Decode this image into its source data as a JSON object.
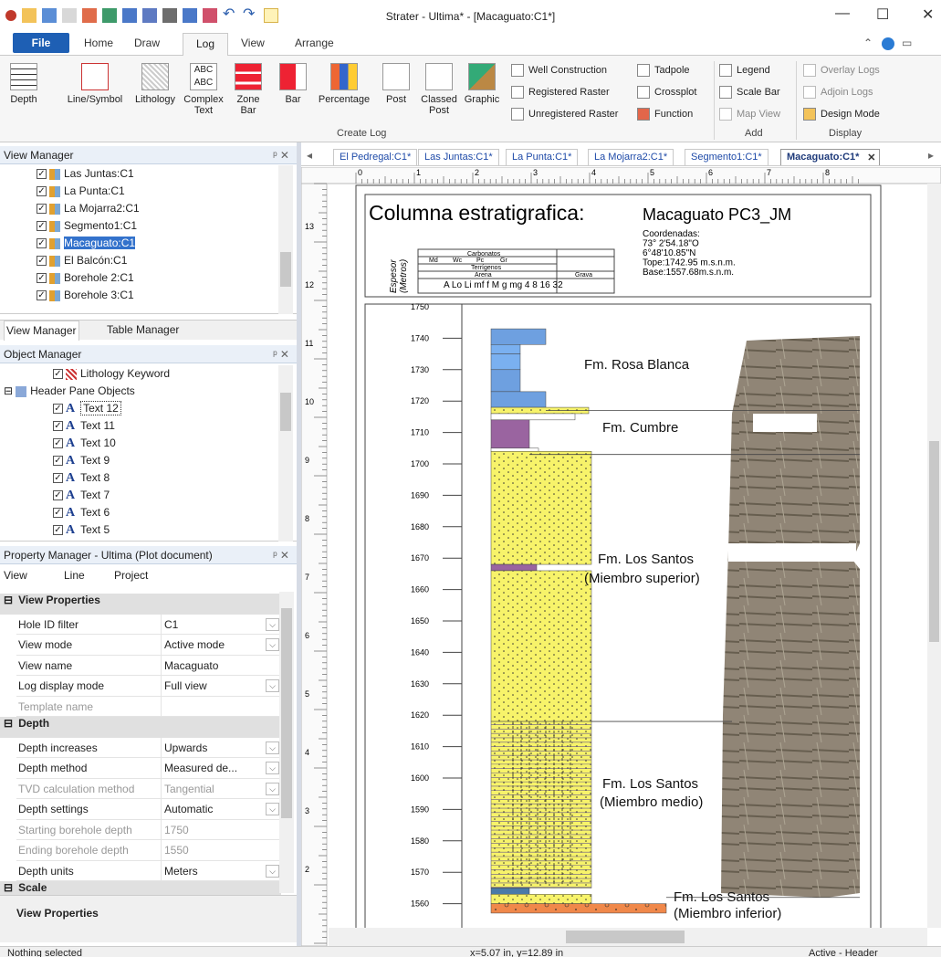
{
  "window": {
    "title": "Strater - Ultima* - [Macaguato:C1*]"
  },
  "ribbon_tabs": [
    "File",
    "Home",
    "Draw",
    "Log",
    "View",
    "Arrange"
  ],
  "ribbon": {
    "create_log": [
      "Depth",
      "Line/Symbol",
      "Lithology",
      "Complex\nText",
      "Zone\nBar",
      "Bar",
      "Percentage",
      "Post",
      "Classed\nPost",
      "Graphic"
    ],
    "create_log_small": [
      "Well Construction",
      "Registered Raster",
      "Unregistered Raster",
      "Tadpole",
      "Crossplot",
      "Function"
    ],
    "add": [
      "Legend",
      "Scale Bar",
      "Map View"
    ],
    "display": [
      "Overlay Logs",
      "Adjoin Logs",
      "Design Mode"
    ],
    "groups": {
      "create": "Create Log",
      "add": "Add",
      "display": "Display"
    }
  },
  "view_manager": {
    "title": "View Manager",
    "items": [
      "Las Juntas:C1",
      "La Punta:C1",
      "La Mojarra2:C1",
      "Segmento1:C1",
      "Macaguato:C1",
      "El Balcón:C1",
      "Borehole 2:C1",
      "Borehole 3:C1"
    ],
    "selected": "Macaguato:C1",
    "tabs": [
      "View Manager",
      "Table Manager"
    ]
  },
  "object_manager": {
    "title": "Object Manager",
    "items": [
      "Lithology Keyword",
      "Header Pane Objects",
      "Text 12",
      "Text 11",
      "Text 10",
      "Text 9",
      "Text 8",
      "Text 7",
      "Text 6",
      "Text 5"
    ]
  },
  "property_manager": {
    "title": "Property Manager - Ultima (Plot document)",
    "tabs": [
      "View",
      "Line",
      "Project"
    ],
    "sections": [
      {
        "name": "View Properties",
        "rows": [
          {
            "name": "Hole ID filter",
            "value": "C1",
            "dd": true
          },
          {
            "name": "View mode",
            "value": "Active mode",
            "dd": true
          },
          {
            "name": "View name",
            "value": "Macaguato",
            "dd": false
          },
          {
            "name": "Log display mode",
            "value": "Full view",
            "dd": true
          },
          {
            "name": "Template name",
            "value": "",
            "dd": false,
            "dis": true
          }
        ]
      },
      {
        "name": "Depth",
        "rows": [
          {
            "name": "Depth increases",
            "value": "Upwards",
            "dd": true
          },
          {
            "name": "Depth method",
            "value": "Measured de...",
            "dd": true
          },
          {
            "name": "TVD calculation method",
            "value": "Tangential",
            "dd": true,
            "dis": true
          },
          {
            "name": "Depth settings",
            "value": "Automatic",
            "dd": true
          },
          {
            "name": "Starting borehole depth",
            "value": "1750",
            "dd": false,
            "dis": true
          },
          {
            "name": "Ending borehole depth",
            "value": "1550",
            "dd": false,
            "dis": true
          },
          {
            "name": "Depth units",
            "value": "Meters",
            "dd": true
          }
        ]
      },
      {
        "name": "Scale",
        "rows": []
      }
    ],
    "footer": "View Properties"
  },
  "doc_tabs": [
    "El Pedregal:C1*",
    "Las Juntas:C1*",
    "La Punta:C1*",
    "La Mojarra2:C1*",
    "Segmento1:C1*",
    "Macaguato:C1*"
  ],
  "active_doc_tab": "Macaguato:C1*",
  "plot": {
    "title_main": "Columna estratigrafica:",
    "title_sub": "Macaguato PC3_JM",
    "coords": [
      "Coordenadas:",
      "73° 2'54.18\"O",
      "6°48'10.85\"N",
      "Tope:1742.95 m.s.n.m.",
      "Base:1557.68m.s.n.m."
    ],
    "legend": {
      "carbonatos": "Carbonatos",
      "carb_cols": [
        "Md",
        "Wc",
        "Pc",
        "Gr"
      ],
      "terrigenos": "Terrígenos",
      "arena": "Arena",
      "grava": "Grava",
      "scale": "A Lo Li  mf  f  M  g mg 4  8 16 32",
      "axis": "Espesor\n(Metros)"
    },
    "depths": [
      "1750",
      "1740",
      "1730",
      "1720",
      "1710",
      "1700",
      "1690",
      "1680",
      "1670",
      "1660",
      "1650",
      "1640",
      "1630",
      "1620",
      "1610",
      "1600",
      "1590",
      "1580",
      "1570",
      "1560"
    ],
    "formations": [
      "Fm. Rosa Blanca",
      "Fm. Cumbre",
      "Fm. Los Santos\n(Miembro superior)",
      "Fm. Los Santos\n(Miembro medio)",
      "Fm. Los Santos\n(Miembro inferior)"
    ],
    "ruler_top": [
      "0",
      "1",
      "2",
      "3",
      "4",
      "5",
      "6",
      "7",
      "8"
    ],
    "ruler_left": [
      "13",
      "12",
      "11",
      "10",
      "9",
      "8",
      "7",
      "6",
      "5",
      "4",
      "3",
      "2"
    ]
  },
  "status": {
    "left": "Nothing selected",
    "mid": "x=5.07 in, y=12.89 in",
    "right": "Active - Header"
  }
}
